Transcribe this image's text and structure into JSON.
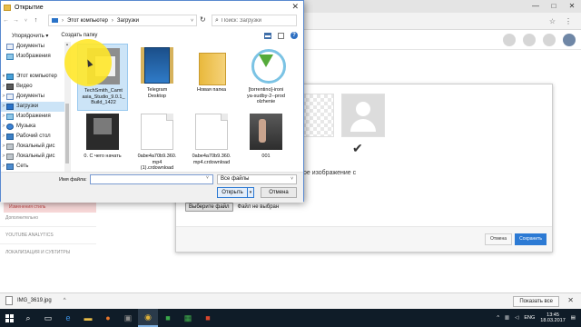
{
  "browser": {
    "window_buttons": [
      "—",
      "□",
      "✕"
    ],
    "toolbar_icons": [
      "star-icon",
      "menu-icon"
    ]
  },
  "page": {
    "left_nav": [
      {
        "label": "Изменения стиль",
        "active": true
      },
      {
        "label": "Дополнительно",
        "active": false
      },
      {
        "label": "YOUTUBE ANALYTICS",
        "active": false
      },
      {
        "label": "ЛОКАЛИЗАЦИЯ И СУБТИТРЫ",
        "active": false
      }
    ],
    "modal": {
      "partial_text": "ое изображение с",
      "choose_file_button": "Выберите файл",
      "no_file_text": "Файл не выбран",
      "cancel_button": "Отмена",
      "save_button": "Сохранить",
      "checkmark": "✔"
    }
  },
  "download_bar": {
    "file_name": "IMG_3619.jpg",
    "show_all": "Показать все",
    "close": "✕"
  },
  "taskbar": {
    "language": "ENG",
    "time": "13:45",
    "date": "18.03.2017"
  },
  "dialog": {
    "title": "Открытие",
    "address": {
      "segments": [
        "Этот компьютер",
        "Загрузки"
      ],
      "separator": "›"
    },
    "search_placeholder": "Поиск: Загрузки",
    "toolbar": {
      "organize": "Упорядочить ▾",
      "new_folder": "Создать папку"
    },
    "nav_tree": [
      {
        "label": "Документы",
        "icon": "ico-doc",
        "caret": ""
      },
      {
        "label": "Изображения",
        "icon": "ico-img",
        "caret": ""
      },
      {
        "label": "",
        "icon": "",
        "caret": ""
      },
      {
        "label": "Этот компьютер",
        "icon": "ico-pc",
        "caret": "▾"
      },
      {
        "label": "Видео",
        "icon": "ico-video",
        "caret": ">"
      },
      {
        "label": "Документы",
        "icon": "ico-doc",
        "caret": ">"
      },
      {
        "label": "Загрузки",
        "icon": "ico-down",
        "caret": ">",
        "selected": true
      },
      {
        "label": "Изображения",
        "icon": "ico-img",
        "caret": ">"
      },
      {
        "label": "Музыка",
        "icon": "ico-music",
        "caret": ">"
      },
      {
        "label": "Рабочий стол",
        "icon": "ico-desk",
        "caret": ">"
      },
      {
        "label": "Локальный дис",
        "icon": "ico-drive",
        "caret": ">"
      },
      {
        "label": "Локальный дис",
        "icon": "ico-drive",
        "caret": ">"
      },
      {
        "label": "Сеть",
        "icon": "ico-net",
        "caret": ">"
      }
    ],
    "files": [
      {
        "label": "TechSmith_Camt\nasia_Studio_9.0.1_\nBuild_1422",
        "pic": "pic-tech",
        "selected": true
      },
      {
        "label": "Telegram\nDesktop",
        "pic": "pic-telegram"
      },
      {
        "label": "Новая папка",
        "pic": "pic-folder"
      },
      {
        "label": "[torrentino]-ironi\nya-sudby-2--prod\nolzhenie",
        "pic": "pic-torrent"
      },
      {
        "label": "0. С чего начать",
        "pic": "pic-video"
      },
      {
        "label": "0abe4a70b9.360.\nmp4\n(1).crdownload",
        "pic": "pic-blank"
      },
      {
        "label": "0abe4a70b9.360.\nmp4.crdownload",
        "pic": "pic-blank"
      },
      {
        "label": "001",
        "pic": "pic-photo"
      }
    ],
    "filename_label": "Имя файла:",
    "filename_value": "",
    "file_filter": "Все файлы",
    "open_button": "Открыть",
    "cancel_button": "Отмена"
  }
}
